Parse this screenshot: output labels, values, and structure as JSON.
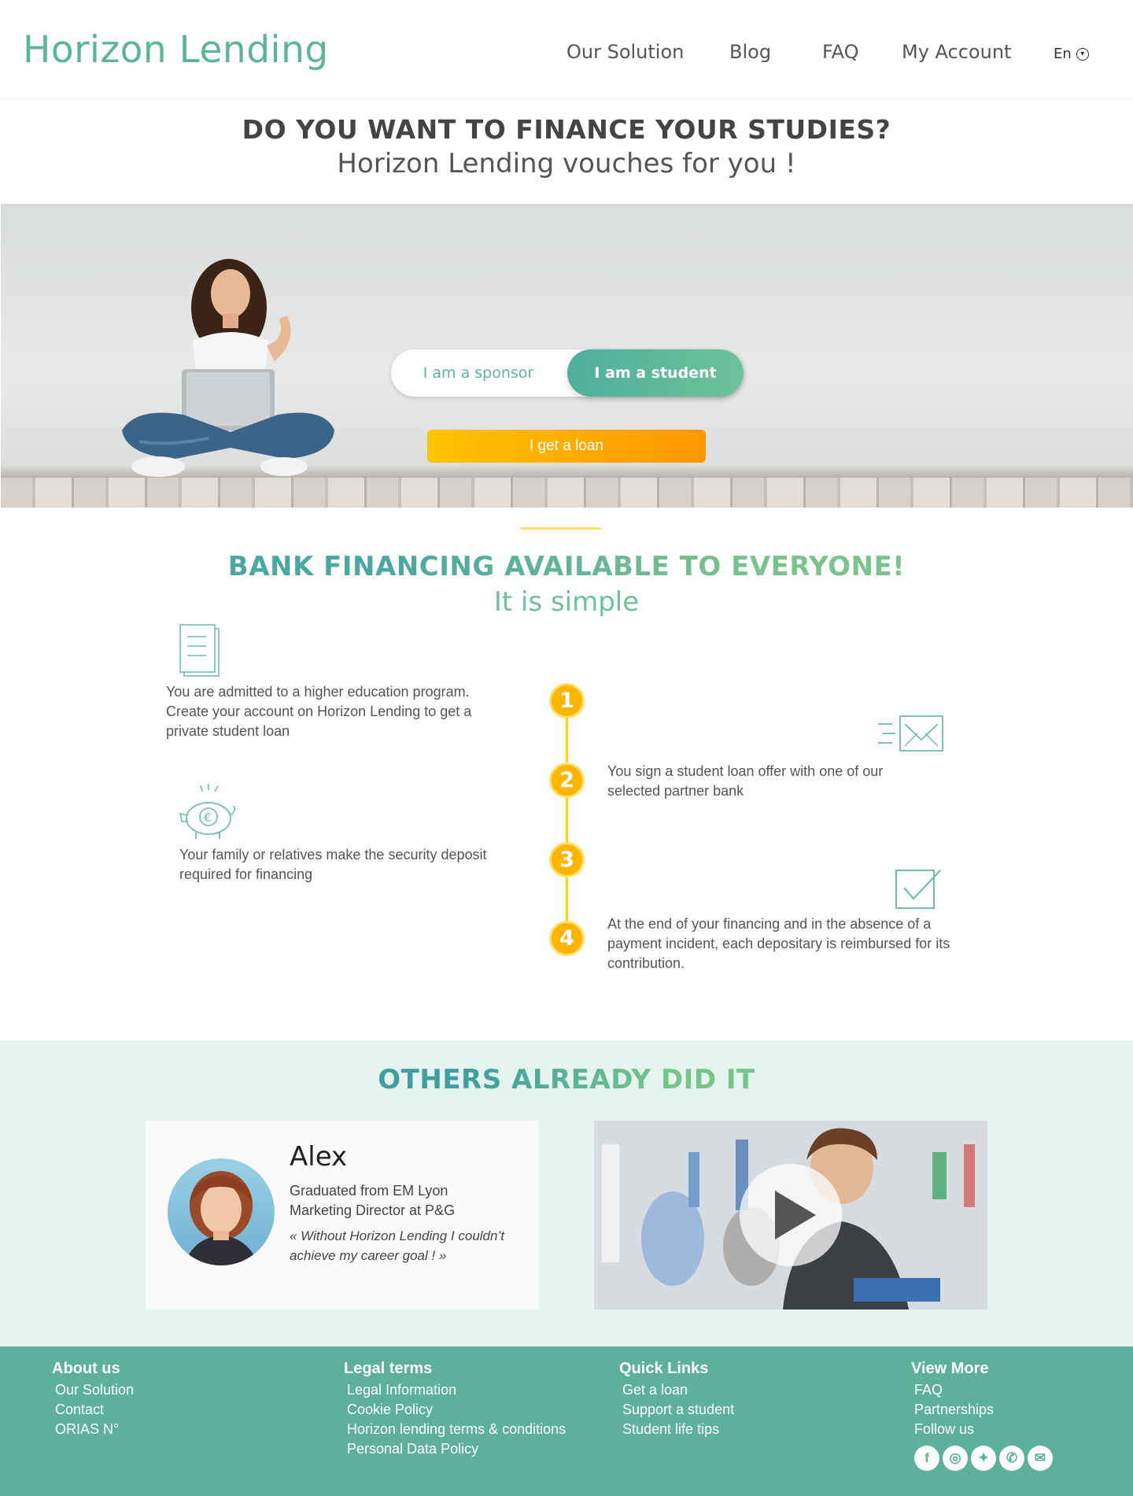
{
  "header": {
    "logo": "Horizon Lending",
    "nav": [
      "Our Solution",
      "Blog",
      "FAQ",
      "My Account"
    ],
    "language": "En"
  },
  "hero": {
    "title": "DO YOU WANT TO FINANCE YOUR STUDIES?",
    "subtitle": "Horizon Lending vouches for you !",
    "toggle_sponsor": "I am a sponsor",
    "toggle_student": "I am a student",
    "cta": "I get a loan"
  },
  "steps": {
    "title": "BANK FINANCING AVAILABLE TO EVERYONE!",
    "subtitle": "It is simple",
    "items": [
      {
        "number": "1",
        "text": "You are admitted to a higher education program. Create your account on Horizon Lending to get a private student loan"
      },
      {
        "number": "2",
        "text": "You sign a student loan offer with one of our selected partner bank"
      },
      {
        "number": "3",
        "text": "Your family or relatives make the security deposit required for financing"
      },
      {
        "number": "4",
        "text": "At the end of your financing and in the absence of a payment incident, each depositary is reimbursed for its contribution."
      }
    ]
  },
  "testimonials": {
    "title": "OTHERS ALREADY DID IT",
    "name": "Alex",
    "line1": "Graduated from EM Lyon",
    "line2": "Marketing Director at P&G",
    "quote": "« Without Horizon Lending I couldn’t achieve my career goal ! »"
  },
  "footer": {
    "about": {
      "heading": "About us",
      "links": [
        "Our Solution",
        "Contact",
        "ORIAS N°"
      ]
    },
    "legal": {
      "heading": "Legal terms",
      "links": [
        "Legal Information",
        "Cookie Policy",
        "Horizon lending terms & conditions",
        "Personal Data Policy"
      ]
    },
    "quick": {
      "heading": "Quick Links",
      "links": [
        "Get a loan",
        "Support a student",
        "Student life tips"
      ]
    },
    "more": {
      "heading": "View More",
      "links": [
        "FAQ",
        "Partnerships",
        "Follow us"
      ]
    },
    "social_icons": [
      "facebook-icon",
      "instagram-icon",
      "twitter-icon",
      "phone-icon",
      "email-icon"
    ]
  },
  "colors": {
    "brand_green": "#5cb59a",
    "footer_green": "#5cb09c",
    "accent_orange": "#ffb400",
    "testimonial_bg": "#e6f4ef"
  }
}
